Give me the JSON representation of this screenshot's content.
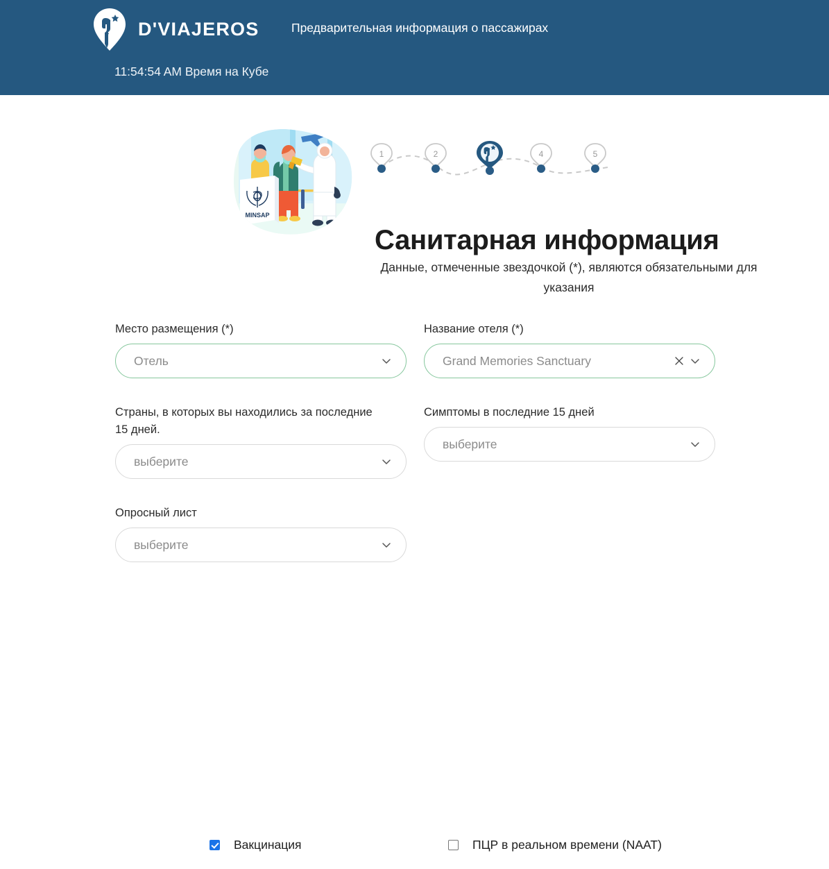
{
  "header": {
    "brand_word": "D'VIAJEROS",
    "logo_icon": "dviajeros-pin-logo-icon",
    "title": "Предварительная информация о пассажирах",
    "clock": "11:54:54 AM Время на Кубе",
    "bg_color": "#255880"
  },
  "illustration": {
    "name": "health-screening-illustration",
    "sign_text": "MINSAP"
  },
  "stepper": {
    "steps": [
      {
        "label": "1",
        "state": "inactive"
      },
      {
        "label": "2",
        "state": "inactive"
      },
      {
        "label": "",
        "state": "active"
      },
      {
        "label": "4",
        "state": "inactive"
      },
      {
        "label": "5",
        "state": "inactive"
      }
    ],
    "active_index": 3,
    "active_color": "#255880",
    "inactive_color": "#c9c9c9"
  },
  "hero": {
    "title": "Санитарная информация",
    "subtitle": "Данные, отмеченные звездочкой (*), являются обязательными для указания"
  },
  "form": {
    "fields": [
      {
        "key": "accommodation_type",
        "label": "Место размещения (*)",
        "value": "Отель",
        "placeholder": "выберите",
        "state": "valid",
        "has_clear": false
      },
      {
        "key": "hotel_name",
        "label": "Название отеля (*)",
        "value": "Grand Memories Sanctuary",
        "placeholder": "выберите",
        "state": "valid",
        "has_clear": true
      },
      {
        "key": "countries_last_15_days",
        "label": "Страны, в которых вы находились за последние 15 дней.",
        "value": "выберите",
        "placeholder": "выберите",
        "state": "empty",
        "has_clear": false
      },
      {
        "key": "symptoms_last_15_days",
        "label": "Симптомы в последние 15 дней",
        "value": "выберите",
        "placeholder": "выберите",
        "state": "empty",
        "has_clear": false
      },
      {
        "key": "questionnaire",
        "label": "Опросный лист",
        "value": "выберите",
        "placeholder": "выберите",
        "state": "empty",
        "has_clear": false
      }
    ],
    "checkboxes": [
      {
        "key": "vaccination",
        "label": "Вакцинация",
        "checked": true
      },
      {
        "key": "pcr_naat",
        "label": "ПЦР в реальном времени (NAAT)",
        "checked": false
      }
    ]
  },
  "colors": {
    "header_blue": "#255880",
    "valid_green": "#86c79d",
    "checkbox_blue": "#1a73e8",
    "border_gray": "#d9d9d9"
  }
}
